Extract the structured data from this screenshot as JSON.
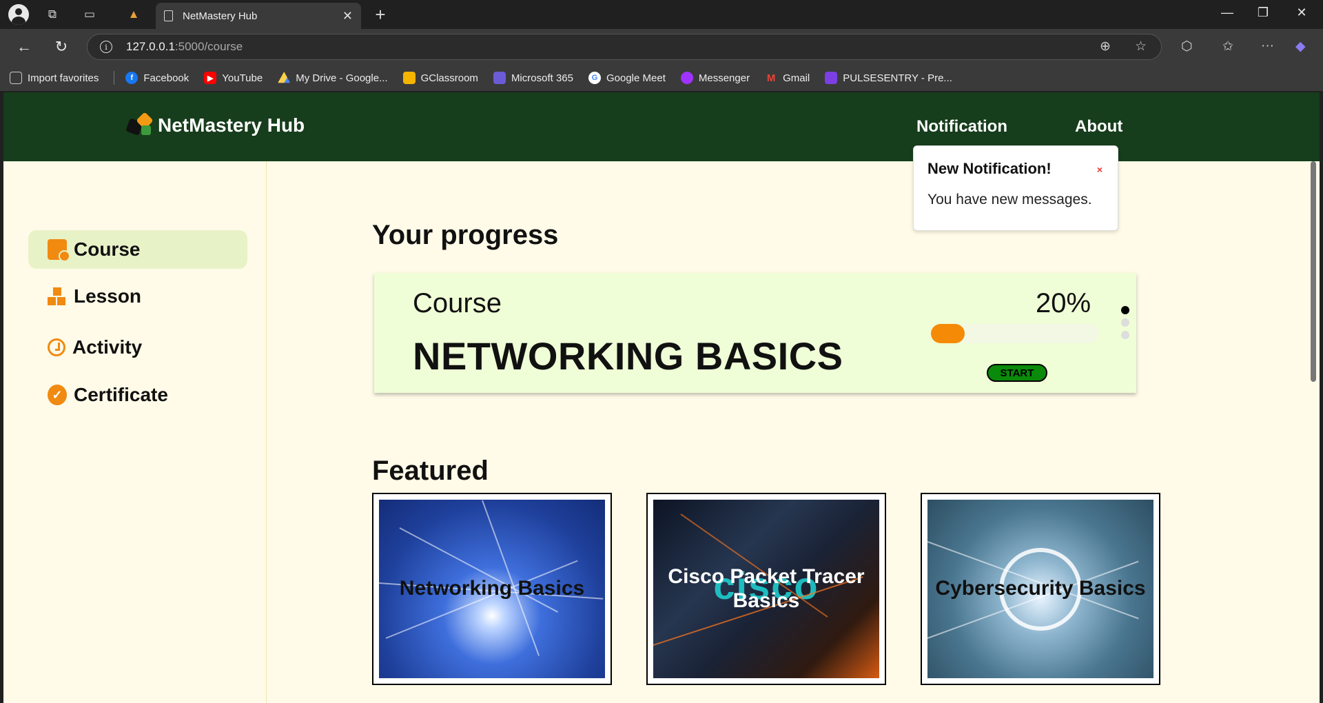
{
  "browser": {
    "tab_title": "NetMastery Hub",
    "url_host": "127.0.0.1",
    "url_path": ":5000/course",
    "favorites": [
      {
        "label": "Import favorites",
        "color": "#555555"
      },
      {
        "label": "Facebook",
        "color": "#1877f2"
      },
      {
        "label": "YouTube",
        "color": "#ff0000"
      },
      {
        "label": "My Drive - Google...",
        "color": "#1fa463"
      },
      {
        "label": "GClassroom",
        "color": "#f4b400"
      },
      {
        "label": "Microsoft 365",
        "color": "#6b5bd6"
      },
      {
        "label": "Google Meet",
        "color": "#ffffff"
      },
      {
        "label": "Messenger",
        "color": "#a033ff"
      },
      {
        "label": "Gmail",
        "color": "#ea4335"
      },
      {
        "label": "PULSESENTRY - Pre...",
        "color": "#7b3fe4"
      }
    ]
  },
  "header": {
    "brand": "NetMastery Hub",
    "nav": {
      "notification": "Notification",
      "about": "About"
    }
  },
  "notification_popup": {
    "title": "New Notification!",
    "close": "×",
    "message": "You have new messages."
  },
  "sidebar": {
    "items": [
      {
        "label": "Course",
        "icon": "course-icon",
        "active": true
      },
      {
        "label": "Lesson",
        "icon": "lesson-icon",
        "active": false
      },
      {
        "label": "Activity",
        "icon": "activity-icon",
        "active": false
      },
      {
        "label": "Certificate",
        "icon": "certificate-icon",
        "active": false
      }
    ]
  },
  "progress": {
    "heading": "Your progress",
    "label": "Course",
    "course_name": "NETWORKING BASICS",
    "percent_text": "20%",
    "percent": 0.2,
    "start_label": "START"
  },
  "featured": {
    "heading": "Featured",
    "cards": [
      {
        "title": "Networking Basics"
      },
      {
        "title": "Cisco Packet Tracer Basics",
        "bg_text": "cisco"
      },
      {
        "title": "Cybersecurity Basics"
      }
    ]
  },
  "colors": {
    "header_bg": "#163d1c",
    "page_bg": "#fffbe8",
    "accent_orange": "#f58a07",
    "start_green": "#0a8a0a"
  }
}
